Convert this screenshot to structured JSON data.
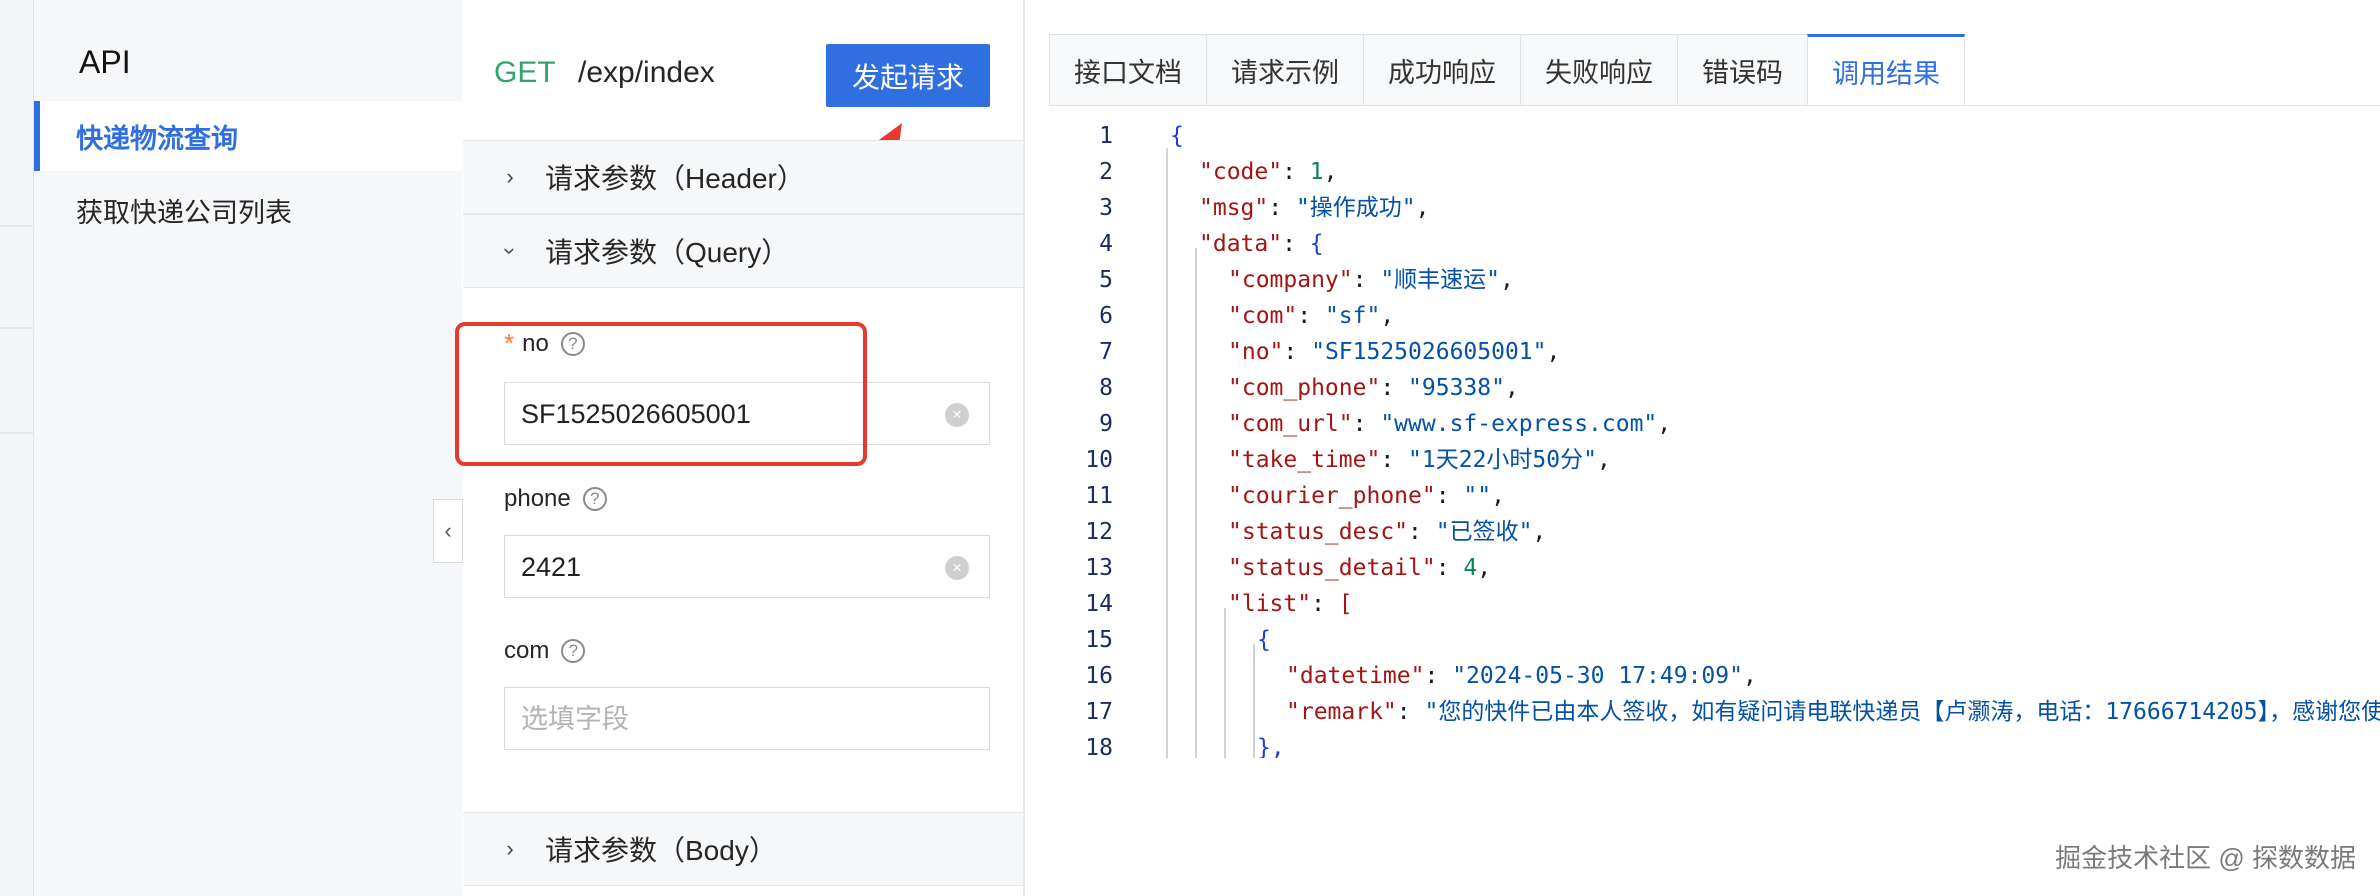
{
  "api_sidebar": {
    "title": "API",
    "items": [
      {
        "label": "快递物流查询",
        "active": true
      },
      {
        "label": "获取快递公司列表",
        "active": false
      }
    ]
  },
  "request": {
    "method": "GET",
    "path": "/exp/index",
    "send_label": "发起请求"
  },
  "sections": {
    "header": "请求参数（Header）",
    "query": "请求参数（Query）",
    "body": "请求参数（Body）"
  },
  "fields": [
    {
      "name": "no",
      "required": true,
      "value": "SF1525026605001",
      "placeholder": "",
      "help": "?"
    },
    {
      "name": "phone",
      "required": false,
      "value": "2421",
      "placeholder": "",
      "help": "?"
    },
    {
      "name": "com",
      "required": false,
      "value": "",
      "placeholder": "选填字段",
      "help": "?"
    }
  ],
  "tabs": [
    {
      "label": "接口文档",
      "active": false
    },
    {
      "label": "请求示例",
      "active": false
    },
    {
      "label": "成功响应",
      "active": false
    },
    {
      "label": "失败响应",
      "active": false
    },
    {
      "label": "错误码",
      "active": false
    },
    {
      "label": "调用结果",
      "active": true
    }
  ],
  "code": {
    "line_numbers": [
      "1",
      "2",
      "3",
      "4",
      "5",
      "6",
      "7",
      "8",
      "9",
      "10",
      "11",
      "12",
      "13",
      "14",
      "15",
      "16",
      "17",
      "18"
    ],
    "lines": [
      [
        {
          "t": "{",
          "c": "b"
        }
      ],
      [
        {
          "t": "\"code\"",
          "c": "k"
        },
        {
          "t": ": ",
          "c": "p"
        },
        {
          "t": "1",
          "c": "n"
        },
        {
          "t": ",",
          "c": "p"
        }
      ],
      [
        {
          "t": "\"msg\"",
          "c": "k"
        },
        {
          "t": ": ",
          "c": "p"
        },
        {
          "t": "\"操作成功\"",
          "c": "s"
        },
        {
          "t": ",",
          "c": "p"
        }
      ],
      [
        {
          "t": "\"data\"",
          "c": "k"
        },
        {
          "t": ": ",
          "c": "p"
        },
        {
          "t": "{",
          "c": "b"
        }
      ],
      [
        {
          "t": "\"company\"",
          "c": "k"
        },
        {
          "t": ": ",
          "c": "p"
        },
        {
          "t": "\"顺丰速运\"",
          "c": "s"
        },
        {
          "t": ",",
          "c": "p"
        }
      ],
      [
        {
          "t": "\"com\"",
          "c": "k"
        },
        {
          "t": ": ",
          "c": "p"
        },
        {
          "t": "\"sf\"",
          "c": "s"
        },
        {
          "t": ",",
          "c": "p"
        }
      ],
      [
        {
          "t": "\"no\"",
          "c": "k"
        },
        {
          "t": ": ",
          "c": "p"
        },
        {
          "t": "\"SF1525026605001\"",
          "c": "s"
        },
        {
          "t": ",",
          "c": "p"
        }
      ],
      [
        {
          "t": "\"com_phone\"",
          "c": "k"
        },
        {
          "t": ": ",
          "c": "p"
        },
        {
          "t": "\"95338\"",
          "c": "s"
        },
        {
          "t": ",",
          "c": "p"
        }
      ],
      [
        {
          "t": "\"com_url\"",
          "c": "k"
        },
        {
          "t": ": ",
          "c": "p"
        },
        {
          "t": "\"www.sf-express.com\"",
          "c": "s"
        },
        {
          "t": ",",
          "c": "p"
        }
      ],
      [
        {
          "t": "\"take_time\"",
          "c": "k"
        },
        {
          "t": ": ",
          "c": "p"
        },
        {
          "t": "\"1天22小时50分\"",
          "c": "s"
        },
        {
          "t": ",",
          "c": "p"
        }
      ],
      [
        {
          "t": "\"courier_phone\"",
          "c": "k"
        },
        {
          "t": ": ",
          "c": "p"
        },
        {
          "t": "\"\"",
          "c": "s"
        },
        {
          "t": ",",
          "c": "p"
        }
      ],
      [
        {
          "t": "\"status_desc\"",
          "c": "k"
        },
        {
          "t": ": ",
          "c": "p"
        },
        {
          "t": "\"已签收\"",
          "c": "s"
        },
        {
          "t": ",",
          "c": "p"
        }
      ],
      [
        {
          "t": "\"status_detail\"",
          "c": "k"
        },
        {
          "t": ": ",
          "c": "p"
        },
        {
          "t": "4",
          "c": "n"
        },
        {
          "t": ",",
          "c": "p"
        }
      ],
      [
        {
          "t": "\"list\"",
          "c": "k"
        },
        {
          "t": ": ",
          "c": "p"
        },
        {
          "t": "[",
          "c": "k"
        }
      ],
      [
        {
          "t": "{",
          "c": "b"
        }
      ],
      [
        {
          "t": "\"datetime\"",
          "c": "k"
        },
        {
          "t": ": ",
          "c": "p"
        },
        {
          "t": "\"2024-05-30 17:49:09\"",
          "c": "s"
        },
        {
          "t": ",",
          "c": "p"
        }
      ],
      [
        {
          "t": "\"remark\"",
          "c": "k"
        },
        {
          "t": ": ",
          "c": "p"
        },
        {
          "t": "\"您的快件已由本人签收，如有疑问请电联快递员【卢灏涛，电话：17666714205】，感谢您使用顺丰",
          "c": "s"
        }
      ],
      [
        {
          "t": "},",
          "c": "b"
        }
      ]
    ]
  },
  "watermark": "掘金技术社区 @ 探数数据",
  "colors": {
    "accent": "#2f6fe0",
    "highlight": "#e53b2f",
    "get_method": "#36a36b"
  }
}
